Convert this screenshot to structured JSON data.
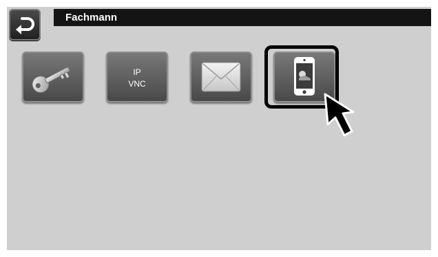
{
  "header": {
    "title": "Fachmann",
    "back_icon": "back-arrow-icon"
  },
  "tiles": [
    {
      "name": "password",
      "icon": "key-icon"
    },
    {
      "name": "ip-vnc",
      "icon": "ip-vnc-icon",
      "line1": "IP",
      "line2": "VNC"
    },
    {
      "name": "email",
      "icon": "envelope-icon"
    },
    {
      "name": "app",
      "icon": "smartphone-icon",
      "selected": true
    }
  ],
  "cursor": {
    "icon": "mouse-pointer-icon"
  },
  "colors": {
    "screen_background": "#cfcfcf",
    "title_bar": "#141414",
    "title_text": "#ffffff",
    "tile_gradient_top": "#7a7a7a",
    "tile_gradient_bottom": "#474747",
    "selection_frame": "#000000"
  }
}
